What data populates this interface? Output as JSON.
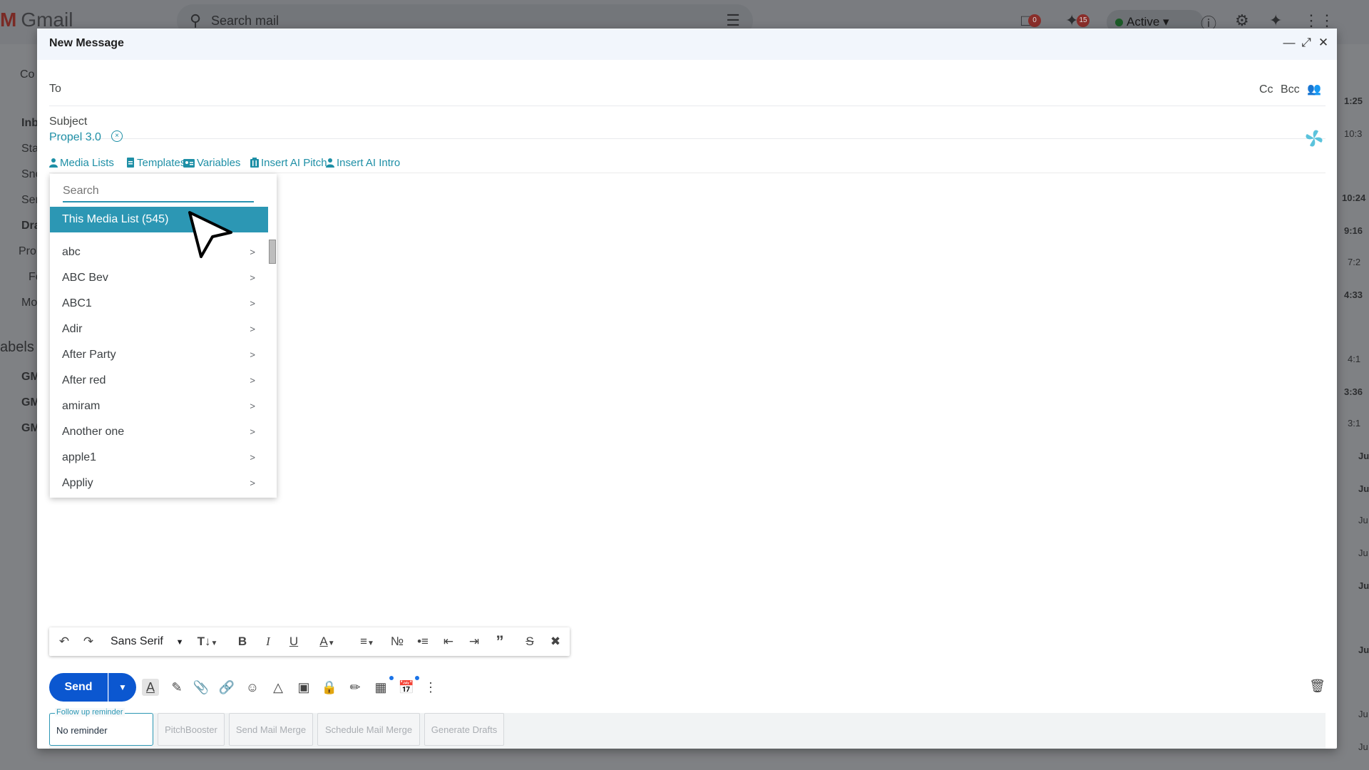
{
  "background": {
    "app_name": "Gmail",
    "search_placeholder": "Search mail",
    "status": "Active",
    "badges": [
      "0",
      "15"
    ],
    "sidebar_fragments": [
      "Co",
      "Inb",
      "Sta",
      "Sno",
      "Sen",
      "Dra",
      "Pro",
      "Fo",
      "Mo",
      "abels",
      "GM",
      "GM",
      "GM"
    ],
    "right_times": [
      "1:25",
      "10:3",
      "10:24",
      "9:16",
      "7:2",
      "4:33",
      "4:1",
      "3:36",
      "3:1",
      "Ju",
      "Ju",
      "Ju",
      "Ju",
      "Ju",
      "Ju",
      "Ju",
      "Ju"
    ]
  },
  "compose": {
    "title": "New Message",
    "to_label": "To",
    "cc_label": "Cc",
    "bcc_label": "Bcc",
    "subject_placeholder": "Subject",
    "propel_label": "Propel 3.0",
    "toolbar": {
      "media_lists": "Media Lists",
      "templates": "Templates",
      "variables": "Variables",
      "insert_ai_pitch": "Insert AI Pitch",
      "insert_ai_intro": "Insert AI Intro"
    },
    "dropdown": {
      "search_placeholder": "Search",
      "selected": "This Media List (545)",
      "items": [
        "abc",
        "ABC Bev",
        "ABC1",
        "Adir",
        "After Party",
        "After red",
        "amiram",
        "Another one",
        "apple1",
        "Appliy"
      ]
    },
    "format_bar": {
      "font": "Sans Serif"
    },
    "send_label": "Send",
    "footer": {
      "reminder_legend": "Follow up reminder",
      "reminder_value": "No reminder",
      "buttons": [
        "PitchBooster",
        "Send Mail Merge",
        "Schedule Mail Merge",
        "Generate Drafts"
      ]
    }
  },
  "colors": {
    "accent": "#2c97b4",
    "propel_text": "#1e8fa6",
    "send": "#0b57d0"
  }
}
